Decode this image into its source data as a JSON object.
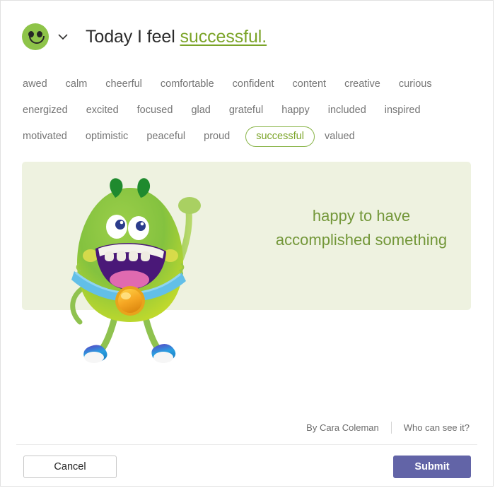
{
  "dialog": {
    "accent_green": "#7ba428",
    "panel_bg": "#eef2e0",
    "submit_purple": "#6264a7"
  },
  "header": {
    "emoji_icon": "smiley-face-icon",
    "chevron_icon": "chevron-down-icon",
    "title_prefix": "Today I feel ",
    "title_mood": "successful."
  },
  "moods": {
    "rows": [
      [
        "awed",
        "calm",
        "cheerful",
        "comfortable",
        "confident",
        "content",
        "creative",
        "curious"
      ],
      [
        "energized",
        "excited",
        "focused",
        "glad",
        "grateful",
        "happy",
        "included",
        "inspired"
      ],
      [
        "motivated",
        "optimistic",
        "peaceful",
        "proud",
        "successful",
        "valued"
      ]
    ],
    "selected": "successful"
  },
  "panel": {
    "caption_line1": "happy to have",
    "caption_line2": "accomplished something",
    "illustration": "green-furry-monster-with-medal-illustration"
  },
  "meta": {
    "author": "By Cara Coleman",
    "privacy_link": "Who can see it?"
  },
  "footer": {
    "cancel_label": "Cancel",
    "submit_label": "Submit"
  }
}
